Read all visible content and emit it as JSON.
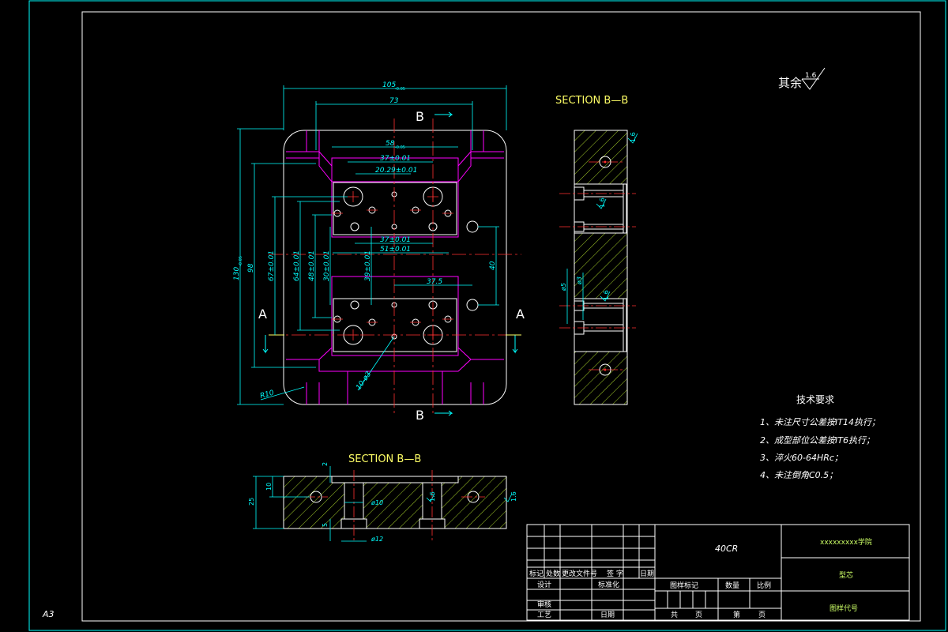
{
  "colors": {
    "background": "#000000",
    "outline": "#ffffff",
    "dimension": "#00ffff",
    "hidden": "#ff00ff",
    "center": "#ff3030",
    "hatch": "#ccff33",
    "cyan_frame": "#00ffff",
    "text_white": "#ffffff",
    "title_text": "#ccff66"
  },
  "sheet": {
    "size_label": "A3"
  },
  "roughness": {
    "label": "其余",
    "value": "1.6"
  },
  "plan_view": {
    "dims": {
      "overall_width": "105",
      "overall_width_tol": "-0.05",
      "width_73": "73",
      "width_58": "58",
      "width_58_tol": "-0.05",
      "width_37_top": "37±0.01",
      "width_20": "20.29±0.01",
      "width_37_mid": "37±0.01",
      "width_51": "51±0.01",
      "overall_height": "130",
      "overall_height_tol": "-0.05",
      "height_98": "98",
      "height_67": "67±0.01",
      "height_64": "64±0.01",
      "height_48": "48±0.01",
      "height_30": "30±0.01",
      "height_39": "39±0.01",
      "height_40": "40",
      "width_37_5": "37.5",
      "hole_callout": "10-ø3",
      "radius": "R10"
    },
    "section_marks": {
      "b": "B",
      "a": "A"
    }
  },
  "side_section": {
    "title": "SECTION  B—B",
    "dims": {
      "d1": "ø5",
      "d2": "ø3",
      "r1": "1.6",
      "r2": "1.6",
      "r3": "1.6"
    }
  },
  "bottom_section": {
    "title": "SECTION  B—B",
    "dims": {
      "h2": "2",
      "h10": "10",
      "h25": "25",
      "h5": "5",
      "d10": "ø10",
      "d12": "ø12",
      "r1": "1.6",
      "r2": "1.6"
    }
  },
  "tech_requirements": {
    "title": "技术要求",
    "items": [
      "1、未注尺寸公差按IT14执行；",
      "2、成型部位公差按IT6执行；",
      "3、淬火60-64HRc；",
      "4、未注倒角C0.5；"
    ]
  },
  "title_block": {
    "material": "40CR",
    "school": "xxxxxxxxx学院",
    "part_name": "型芯",
    "drawing_code": "图样代号",
    "headers": [
      "标记",
      "处数",
      "更改文件号",
      "签  字",
      "日期"
    ],
    "design": "设计",
    "standardize": "标准化",
    "review": "审核",
    "process": "工艺",
    "date": "日期",
    "mark_label": "图样标记",
    "qty_label": "数量",
    "scale_label": "比例",
    "total_label": "共",
    "page_label": "页",
    "sheet_label": "第",
    "page_label2": "页"
  }
}
